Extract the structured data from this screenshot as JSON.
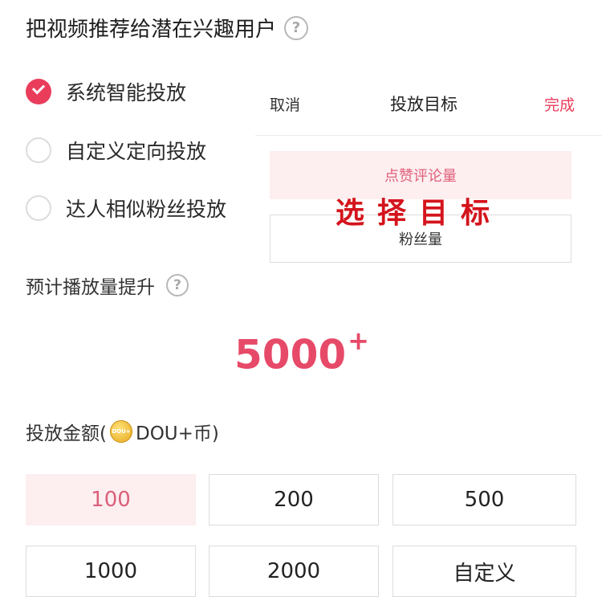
{
  "header": {
    "title": "把视频推荐给潜在兴趣用户",
    "help_icon": "question-circle-icon"
  },
  "targeting_options": [
    {
      "label": "系统智能投放",
      "checked": true
    },
    {
      "label": "自定义定向投放",
      "checked": false
    },
    {
      "label": "达人相似粉丝投放",
      "checked": false
    }
  ],
  "goal_sheet": {
    "cancel_label": "取消",
    "title": "投放目标",
    "done_label": "完成",
    "options": [
      {
        "label": "点赞评论量",
        "selected": true
      },
      {
        "label": "粉丝量",
        "selected": false
      }
    ]
  },
  "annotation": {
    "text": "选择目标"
  },
  "estimate": {
    "label": "预计播放量提升",
    "value": "5000",
    "suffix": "+"
  },
  "amount": {
    "label_prefix": "投放金额(",
    "coin_icon": "dou-coin-icon",
    "coin_text": "DOU+",
    "label_suffix": "DOU+币)",
    "options": [
      {
        "label": "100",
        "selected": true
      },
      {
        "label": "200",
        "selected": false
      },
      {
        "label": "500",
        "selected": false
      },
      {
        "label": "1000",
        "selected": false
      },
      {
        "label": "2000",
        "selected": false
      },
      {
        "label": "自定义",
        "selected": false
      }
    ]
  },
  "colors": {
    "accent": "#ea3d5c",
    "selected_bg": "#fdeef0",
    "annotation": "#d4141c"
  }
}
